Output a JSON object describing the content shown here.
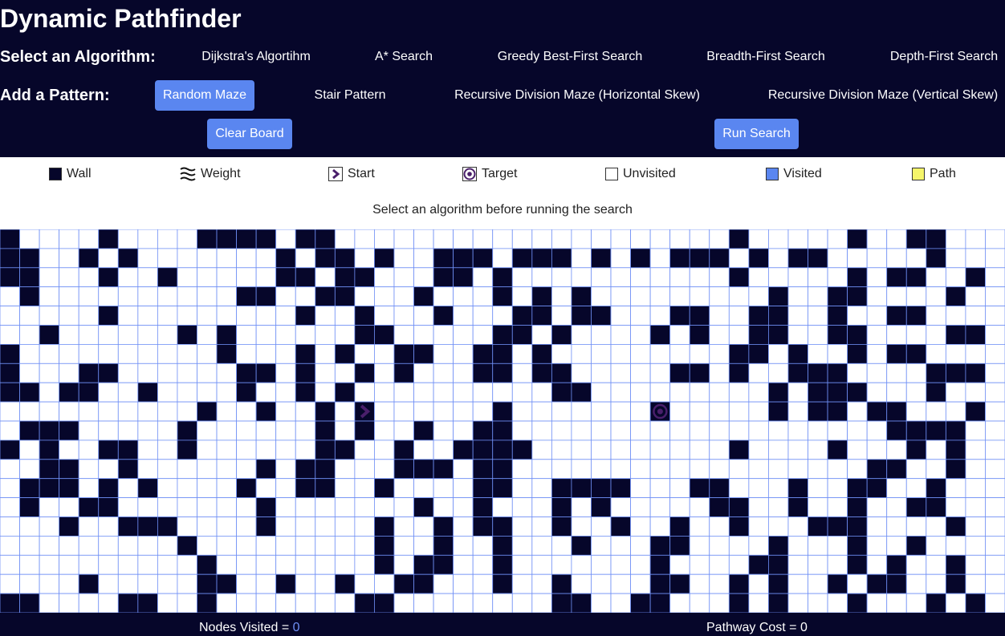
{
  "title": "Dynamic Pathfinder",
  "algorithms": {
    "label": "Select an Algorithm:",
    "items": [
      "Dijkstra's Algortihm",
      "A* Search",
      "Greedy Best-First Search",
      "Breadth-First Search",
      "Depth-First Search"
    ]
  },
  "patterns": {
    "label": "Add a Pattern:",
    "items": [
      "Random Maze",
      "Stair Pattern",
      "Recursive Division Maze (Horizontal Skew)",
      "Recursive Division Maze (Vertical Skew)"
    ],
    "selected": "Random Maze"
  },
  "buttons": {
    "clear": "Clear Board",
    "run": "Run Search"
  },
  "legend": {
    "wall": "Wall",
    "weight": "Weight",
    "start": "Start",
    "target": "Target",
    "unvisited": "Unvisited",
    "visited": "Visited",
    "path": "Path"
  },
  "message": "Select an algorithm before running the search",
  "stats": {
    "nodes_label": "Nodes Visited = ",
    "nodes_value": "0",
    "cost_label": "Pathway Cost = ",
    "cost_value": "0"
  },
  "colors": {
    "header_bg": "#06062a",
    "accent": "#5a86f0",
    "wall": "#06062a",
    "grid_line": "#6f8ff5",
    "visited": "#5a86f0",
    "path": "#f5f56a",
    "start_target": "#4a1f6b"
  },
  "grid": {
    "rows": 20,
    "cols": 51,
    "start": [
      9,
      18
    ],
    "target": [
      9,
      33
    ],
    "walls": [
      "#....#....####.##....................#.....#..##..",
      "##..#.#.......#.##.#..###.###.#.#.###.#.##.....#..",
      "##...#..#.....##.##...##.#...........#.....#.##..#",
      ".#..........##..##...#...#.#.#.........#..##....#.",
      ".....#.........#..#...#...##.##...##..##..#..##...",
      "..#......#.#......##.....##.#....#.#..##..##....##",
      "#..........#...#.#..##..##.#.........##.#..#.##...",
      "#...##......##.#..#.#...##.##.....##.#..###....###",
      "##.##..#....#..#.#..........##.........#.###...#..",
      "..........#..#..#.#......#.......#.....#.##.##...#",
      ".###.....#......#.#..#..##...................####.",
      "#.#..##..#......##..#..####..........#....#...#.#.",
      "..##..#......#.##...###.##..................##..#.",
      ".###.#.#....#..##..#....##..####...##...#..##..#..",
      ".#..##.......#.......#..#...#.#.....##..#..#..##..",
      "...#..###....#.....#..#.##..#..#..#..#...###....#.",
      ".........#.........#..#..#...#...##....#...#..#...",
      "..........#........#.##..#.......#....##...#.#..#.",
      "....#.....##..#..#..##...#..#....##..#.#..#.##..#.",
      "##....##..#.......##........##..##...#.#...#...#.#"
    ]
  }
}
